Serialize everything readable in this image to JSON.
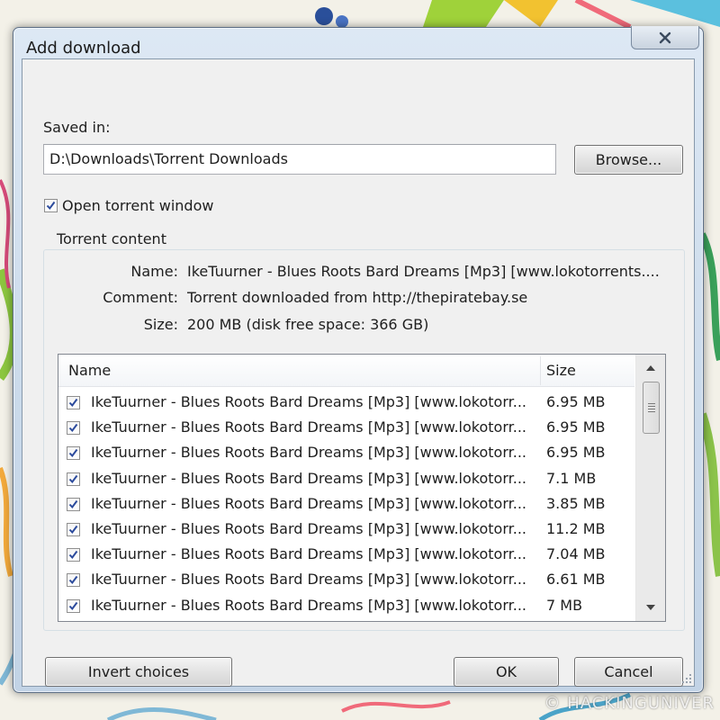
{
  "window": {
    "title": "Add download"
  },
  "saved_in": {
    "label": "Saved in:",
    "path": "D:\\Downloads\\Torrent Downloads",
    "browse_label": "Browse..."
  },
  "open_torrent_window": {
    "label": "Open torrent window",
    "checked": true
  },
  "torrent_content": {
    "group_label": "Torrent content",
    "name_key": "Name:",
    "name_value": "IkeTuurner - Blues Roots Bard Dreams [Mp3] [www.lokotorrents....",
    "comment_key": "Comment:",
    "comment_value": "Torrent downloaded from http://thepiratebay.se",
    "size_key": "Size:",
    "size_value": "200 MB (disk free space: 366 GB)"
  },
  "file_list": {
    "columns": {
      "name": "Name",
      "size": "Size"
    },
    "rows": [
      {
        "name": "IkeTuurner - Blues Roots Bard Dreams [Mp3] [www.lokotorr...",
        "size": "6.95 MB",
        "checked": true
      },
      {
        "name": "IkeTuurner - Blues Roots Bard Dreams [Mp3] [www.lokotorr...",
        "size": "6.95 MB",
        "checked": true
      },
      {
        "name": "IkeTuurner - Blues Roots Bard Dreams [Mp3] [www.lokotorr...",
        "size": "6.95 MB",
        "checked": true
      },
      {
        "name": "IkeTuurner - Blues Roots Bard Dreams [Mp3] [www.lokotorr...",
        "size": "7.1 MB",
        "checked": true
      },
      {
        "name": "IkeTuurner - Blues Roots Bard Dreams [Mp3] [www.lokotorr...",
        "size": "3.85 MB",
        "checked": true
      },
      {
        "name": "IkeTuurner - Blues Roots Bard Dreams [Mp3] [www.lokotorr...",
        "size": "11.2 MB",
        "checked": true
      },
      {
        "name": "IkeTuurner - Blues Roots Bard Dreams [Mp3] [www.lokotorr...",
        "size": "7.04 MB",
        "checked": true
      },
      {
        "name": "IkeTuurner - Blues Roots Bard Dreams [Mp3] [www.lokotorr...",
        "size": "6.61 MB",
        "checked": true
      },
      {
        "name": "IkeTuurner - Blues Roots Bard Dreams [Mp3] [www.lokotorr...",
        "size": "7 MB",
        "checked": true
      }
    ]
  },
  "buttons": {
    "invert_choices": "Invert choices",
    "ok": "OK",
    "cancel": "Cancel"
  },
  "watermark": "© HACKINGUNIVER",
  "colors": {
    "check": "#2b4a9c",
    "window_frame": "#c9d9ea",
    "client_bg": "#f0f0f0"
  },
  "icons": {
    "close": "close-icon",
    "scroll_up": "chevron-up-icon",
    "scroll_down": "chevron-down-icon",
    "checkbox": "checkmark-icon",
    "resize": "resize-grip-icon"
  }
}
